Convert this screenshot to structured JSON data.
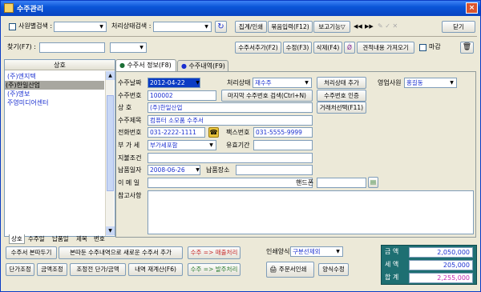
{
  "window": {
    "title": "수주관리",
    "close": "×"
  },
  "toolbar1": {
    "customer_search_label": "사원별검색 :",
    "status_search_label": "처리상태검색 :",
    "refresh_icon": "refresh-icon",
    "btn_aggregate": "집계/인쇄",
    "btn_bulk_input": "묶음입력(F12)",
    "btn_report": "보고기능▽",
    "nav_first": "◀◀",
    "nav_next": "▶▶",
    "btn_close": "닫기"
  },
  "toolbar2": {
    "find_label": "찾기(F7) :",
    "btn_add_order": "수주서추가(F2)",
    "btn_edit": "수정(F3)",
    "btn_delete": "삭제(F4)",
    "btn_import_quote": "견적내용 가져오기",
    "deadline_label": "마감"
  },
  "list": {
    "header": "상호",
    "items": [
      {
        "name": "(주)엔지텍",
        "selected": false
      },
      {
        "name": "(주)한일산업",
        "selected": true
      },
      {
        "name": "(주)명보",
        "selected": false
      },
      {
        "name": "주영미디어센터",
        "selected": false
      }
    ],
    "tabs": [
      "상호",
      "수주일",
      "납품일",
      "제목",
      "번호"
    ]
  },
  "tabs": [
    {
      "label": "수주서 정보(F8)",
      "active": true
    },
    {
      "label": "수주내역(F9)",
      "active": false
    }
  ],
  "form": {
    "order_date_label": "수주날짜",
    "order_date": "2012-04-22",
    "status_label": "처리상태",
    "status_value": "재수주",
    "btn_add_status": "처리상태 추가",
    "sales_rep_label": "영업사원",
    "sales_rep_value": "홍길동",
    "order_no_label": "수주번호",
    "order_no": "100002",
    "btn_last_order": "마지막 수주번호 검색(Ctrl+N)",
    "btn_verify_order": "수주번호 인증",
    "company_label": "상 호",
    "company_value": "(주)한일산업",
    "btn_select_client": "거래처선택(F11)",
    "title_label": "수주제목",
    "title_value": "컴퓨터 소모품 수주서",
    "phone_label": "전화번호",
    "phone_value": "031-2222-1111",
    "fax_label": "팩스번호",
    "fax_value": "031-5555-9999",
    "vat_label": "부 가 세",
    "vat_value": "부가세포함",
    "validity_label": "유효기간",
    "payment_label": "지불조건",
    "delivery_date_label": "납품일자",
    "delivery_date": "2008-06-26",
    "delivery_place_label": "납품장소",
    "email_label": "이 메 일",
    "mobile_label": "핸드폰",
    "notes_label": "참고사항"
  },
  "bottom": {
    "btn_copy_order": "수주서 본따두기",
    "btn_new_from_order": "본따둔 수주내역으로 새로운 수주서 추가",
    "btn_to_sales": "수주 => 매출처리",
    "btn_unit_adjust": "단가조정",
    "btn_amount_adjust": "금액조정",
    "btn_adjusted_unit": "조정전 단가/금액",
    "btn_recalc": "내역 재계산(F6)",
    "btn_to_purchase": "수주 => 발주처리",
    "print_style_label": "인쇄양식",
    "print_style_value": "구분선제외",
    "btn_print_order": "주문서인쇄",
    "btn_style_edit": "양식수정"
  },
  "totals": {
    "amount_label": "금 액",
    "amount": "2,050,000",
    "tax_label": "세 액",
    "tax": "205,000",
    "sum_label": "합 계",
    "sum": "2,255,000"
  }
}
